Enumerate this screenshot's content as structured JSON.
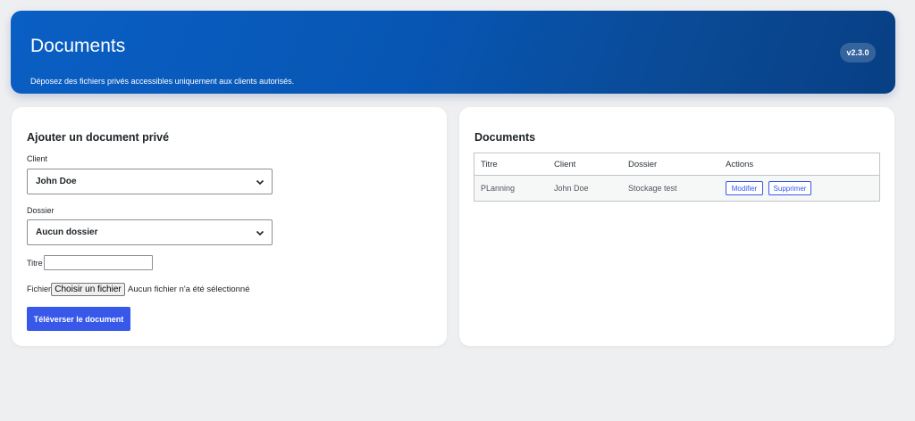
{
  "header": {
    "title": "Documents",
    "subtitle": "Déposez des fichiers privés accessibles uniquement aux clients autorisés.",
    "version": "v2.3.0"
  },
  "form": {
    "title": "Ajouter un document privé",
    "client_label": "Client",
    "client_value": "John Doe",
    "folder_label": "Dossier",
    "folder_value": "Aucun dossier",
    "title_label": "Titre",
    "title_value": "",
    "file_label": "Fichier",
    "file_button": "Choisir un fichier",
    "file_status": "Aucun fichier n'a été sélectionné",
    "submit_label": "Téléverser le document"
  },
  "documents": {
    "title": "Documents",
    "columns": [
      "Titre",
      "Client",
      "Dossier",
      "Actions"
    ],
    "rows": [
      {
        "title": "PLanning",
        "client": "John Doe",
        "folder": "Stockage test",
        "edit": "Modifier",
        "delete": "Supprimer"
      }
    ]
  },
  "colors": {
    "header_gradient_start": "#0a5fc4",
    "header_gradient_end": "#083f84",
    "primary_button": "#3858e9",
    "background": "#eeeff1"
  }
}
